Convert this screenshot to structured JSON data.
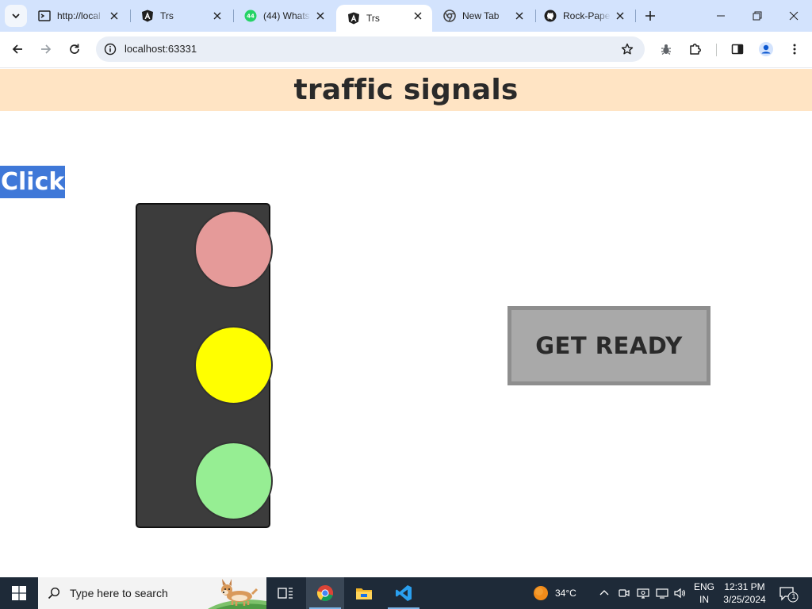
{
  "browser": {
    "tabs": [
      {
        "title": "http://local",
        "favicon": "terminal-icon",
        "active": false
      },
      {
        "title": "Trs",
        "favicon": "angular-icon",
        "active": false
      },
      {
        "title": "(44) Whats",
        "favicon": "whatsapp-icon",
        "badge": "44",
        "active": false
      },
      {
        "title": "Trs",
        "favicon": "angular-icon",
        "active": true
      },
      {
        "title": "New Tab",
        "favicon": "chrome-icon",
        "active": false
      },
      {
        "title": "Rock-Pape",
        "favicon": "github-icon",
        "active": false
      }
    ],
    "url": "localhost:63331"
  },
  "page": {
    "title": "traffic signals",
    "click_label": "Click",
    "status_label": "GET READY",
    "lights": [
      {
        "name": "red",
        "color": "#e59a99"
      },
      {
        "name": "yellow",
        "color": "#ffff00"
      },
      {
        "name": "green",
        "color": "#96ee93"
      }
    ],
    "header_color": "#ffe4c4",
    "click_color": "#3f78d8"
  },
  "taskbar": {
    "search_placeholder": "Type here to search",
    "weather": "34°C",
    "lang_top": "ENG",
    "lang_bottom": "IN",
    "time": "12:31 PM",
    "date": "3/25/2024",
    "notification_count": "1"
  }
}
